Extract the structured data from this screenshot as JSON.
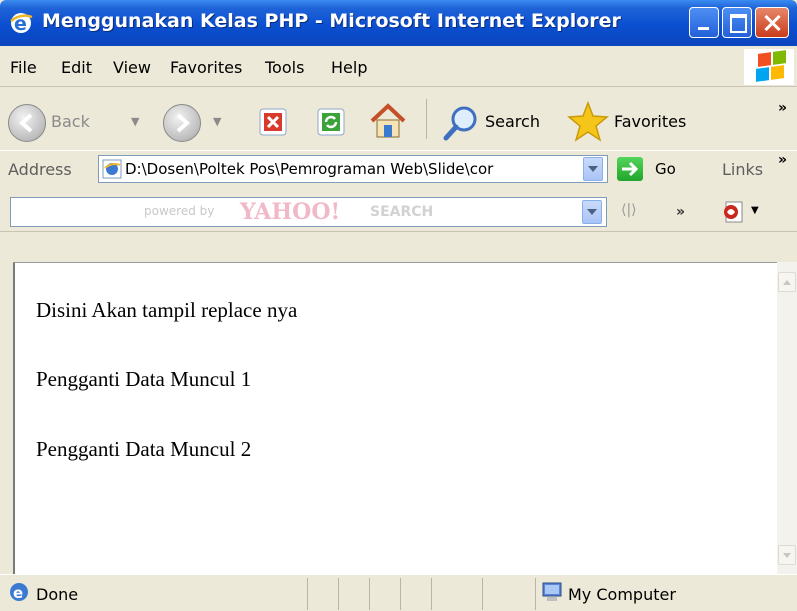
{
  "window": {
    "title": "Menggunakan Kelas PHP - Microsoft Internet Explorer"
  },
  "menu": {
    "items": [
      "File",
      "Edit",
      "View",
      "Favorites",
      "Tools",
      "Help"
    ]
  },
  "toolbar": {
    "back_label": "Back",
    "search_label": "Search",
    "favorites_label": "Favorites",
    "overflow": "»"
  },
  "address": {
    "label": "Address",
    "value": "D:\\Dosen\\Poltek Pos\\Pemrograman Web\\Slide\\cor",
    "go_label": "Go",
    "links_label": "Links",
    "links_overflow": "»"
  },
  "yahoo": {
    "powered_by": "powered by",
    "logo": "YAHOO!",
    "search": "SEARCH",
    "overflow": "»"
  },
  "page": {
    "lines": [
      "Disini Akan tampil replace nya",
      "Pengganti Data Muncul 1",
      "Pengganti Data Muncul 2"
    ]
  },
  "status": {
    "text": "Done",
    "zone": "My Computer"
  },
  "colors": {
    "titlebar": "#0a4fd0",
    "chrome": "#ece9d8",
    "content_bg": "#ffffff"
  },
  "icons": [
    "ie-icon",
    "back-icon",
    "forward-icon",
    "stop-icon",
    "refresh-icon",
    "home-icon",
    "search-icon",
    "favorites-star-icon",
    "go-arrow-icon",
    "pdf-icon",
    "computer-icon",
    "windows-logo-icon"
  ]
}
